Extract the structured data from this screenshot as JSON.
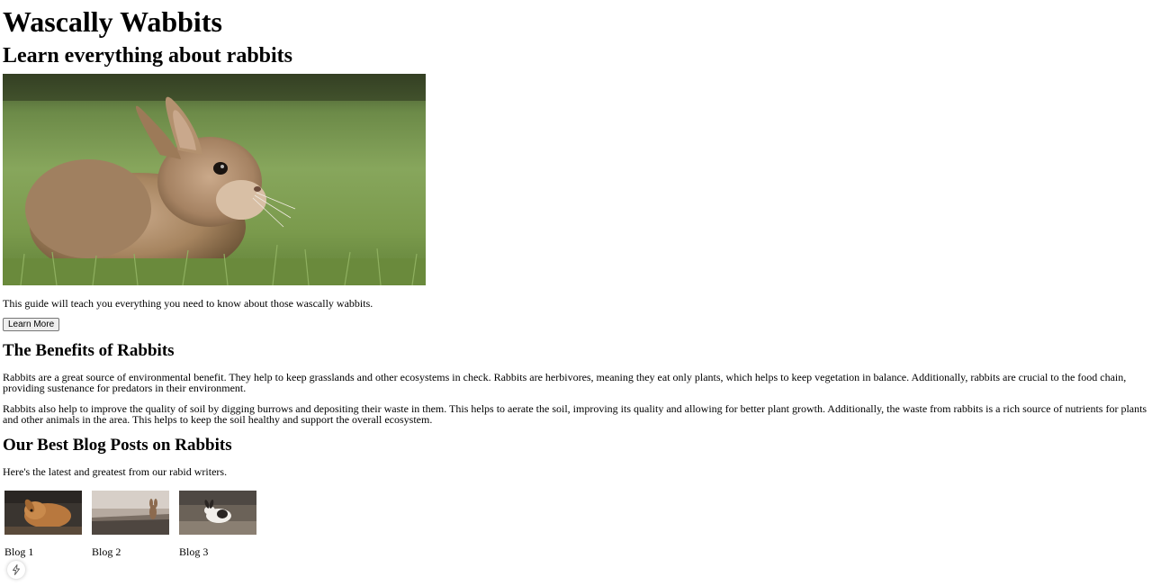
{
  "header": {
    "title": "Wascally Wabbits",
    "subtitle": "Learn everything about rabbits"
  },
  "hero": {
    "image_alt": "rabbit sitting in grass",
    "description": "This guide will teach you everything you need to know about those wascally wabbits.",
    "button_label": "Learn More"
  },
  "benefits": {
    "heading": "The Benefits of Rabbits",
    "paragraph1": "Rabbits are a great source of environmental benefit. They help to keep grasslands and other ecosystems in check. Rabbits are herbivores, meaning they eat only plants, which helps to keep vegetation in balance. Additionally, rabbits are crucial to the food chain, providing sustenance for predators in their environment.",
    "paragraph2": "Rabbits also help to improve the quality of soil by digging burrows and depositing their waste in them. This helps to aerate the soil, improving its quality and allowing for better plant growth. Additionally, the waste from rabbits is a rich source of nutrients for plants and other animals in the area. This helps to keep the soil healthy and support the overall ecosystem."
  },
  "blog": {
    "heading": "Our Best Blog Posts on Rabbits",
    "intro": "Here's the latest and greatest from our rabid writers.",
    "posts": [
      {
        "title": "Blog 1"
      },
      {
        "title": "Blog 2"
      },
      {
        "title": "Blog 3"
      }
    ]
  },
  "floating_button": {
    "icon": "lightning-icon"
  },
  "colors": {
    "background": "#ffffff",
    "text": "#000000",
    "button_bg": "#efefef",
    "button_border": "#767676"
  }
}
